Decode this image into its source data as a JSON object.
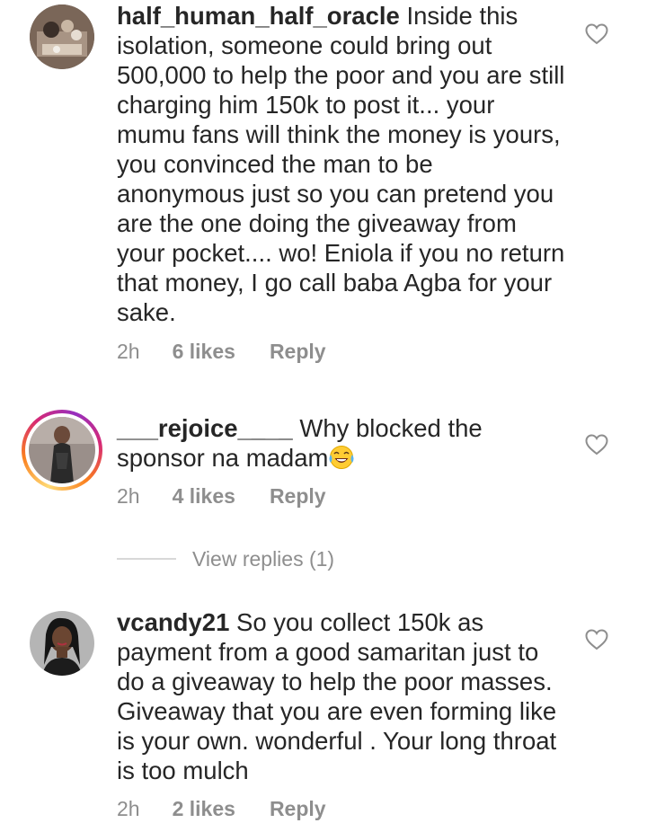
{
  "comments": [
    {
      "username": "half_human_half_oracle",
      "text": " Inside this isolation, someone could bring out 500,000 to help the poor and you are still charging him 150k to post it... your mumu fans will think the money is yours, you convinced the man to be anonymous just so you can pretend you are the one doing the giveaway from your pocket.... wo! Eniola if you no return that money, I go call baba Agba for your sake.",
      "time": "2h",
      "likes": "6 likes",
      "reply": "Reply"
    },
    {
      "username": "___rejoice____",
      "text": " Why blocked the sponsor na madam",
      "emoji": "😂",
      "time": "2h",
      "likes": "4 likes",
      "reply": "Reply",
      "view_replies": "View replies (1)"
    },
    {
      "username": "vcandy21",
      "text": " So you collect 150k as payment from a good samaritan just to do a giveaway to help the poor masses. Giveaway that you are even forming like is your own. wonderful . Your long throat is too mulch",
      "time": "2h",
      "likes": "2 likes",
      "reply": "Reply"
    }
  ],
  "icons": {
    "like": "heart-outline-icon",
    "story_ring": "story-ring"
  },
  "colors": {
    "text": "#262626",
    "meta": "#8e8e8e",
    "divider": "#d8d8d8"
  }
}
